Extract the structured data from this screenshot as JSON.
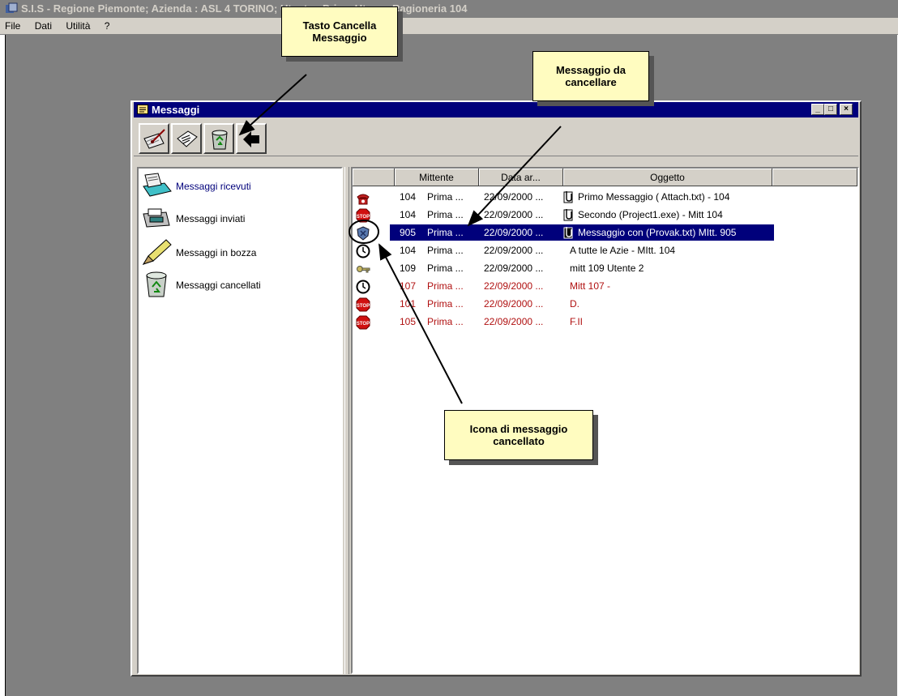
{
  "app": {
    "title": "S.I.S - Regione Piemonte; Azienda : ASL 4 TORINO; Utente : Prima Utenza Ragioneria 104",
    "menu": [
      "File",
      "Dati",
      "Utilità",
      "?"
    ]
  },
  "window": {
    "title": "Messaggi",
    "controls": [
      "_",
      "□",
      "×"
    ]
  },
  "toolbar": {
    "buttons": [
      {
        "name": "new-message",
        "icon": "pen-letter-icon"
      },
      {
        "name": "reply",
        "icon": "envelope-icon"
      },
      {
        "name": "delete-message",
        "icon": "recycle-bin-icon"
      },
      {
        "name": "exit",
        "icon": "back-arrow-icon"
      }
    ]
  },
  "folders": [
    {
      "label": "Messaggi ricevuti",
      "icon": "inbox-tray-icon",
      "active": true
    },
    {
      "label": "Messaggi inviati",
      "icon": "fax-icon",
      "active": false
    },
    {
      "label": "Messaggi in bozza",
      "icon": "pencil-icon",
      "active": false
    },
    {
      "label": "Messaggi cancellati",
      "icon": "recycle-bin-icon",
      "active": false
    }
  ],
  "list": {
    "columns": [
      "",
      "Mittente",
      "Data ar...",
      "Oggetto"
    ],
    "rows": [
      {
        "icon": "phone-icon",
        "id": "104",
        "sender": "Prima ...",
        "date": "22/09/2000 ...",
        "attach": true,
        "subject": "Primo Messaggio ( Attach.txt) - 104",
        "red": false,
        "selected": false
      },
      {
        "icon": "stop-icon",
        "id": "104",
        "sender": "Prima ...",
        "date": "22/09/2000 ...",
        "attach": true,
        "subject": "Secondo (Project1.exe) - Mitt 104",
        "red": false,
        "selected": false
      },
      {
        "icon": "deleted-shield-icon",
        "id": "905",
        "sender": "Prima ...",
        "date": "22/09/2000 ...",
        "attach": true,
        "subject": "Messaggio con (Provak.txt) MItt. 905",
        "red": false,
        "selected": true
      },
      {
        "icon": "clock-icon",
        "id": "104",
        "sender": "Prima ...",
        "date": "22/09/2000 ...",
        "attach": false,
        "subject": "A tutte le Azie - MItt. 104",
        "red": false,
        "selected": false
      },
      {
        "icon": "key-icon",
        "id": "109",
        "sender": "Prima ...",
        "date": "22/09/2000 ...",
        "attach": false,
        "subject": "mitt 109 Utente 2",
        "red": false,
        "selected": false
      },
      {
        "icon": "clock-icon",
        "id": "107",
        "sender": "Prima ...",
        "date": "22/09/2000 ...",
        "attach": false,
        "subject": "Mitt 107 -",
        "red": true,
        "selected": false
      },
      {
        "icon": "stop-icon",
        "id": "101",
        "sender": "Prima ...",
        "date": "22/09/2000 ...",
        "attach": false,
        "subject": "D.",
        "red": true,
        "selected": false
      },
      {
        "icon": "stop-icon",
        "id": "105",
        "sender": "Prima ...",
        "date": "22/09/2000 ...",
        "attach": false,
        "subject": "F.II",
        "red": true,
        "selected": false
      }
    ]
  },
  "callouts": {
    "delete_button": "Tasto Cancella Messaggio",
    "message_to_delete": "Messaggio da cancellare",
    "deleted_icon": "Icona di messaggio cancellato"
  },
  "colors": {
    "title_active": "#00007b",
    "desktop": "#808080",
    "face": "#d4d0c8",
    "callout": "#fffcc0",
    "unread_red": "#b01010"
  }
}
